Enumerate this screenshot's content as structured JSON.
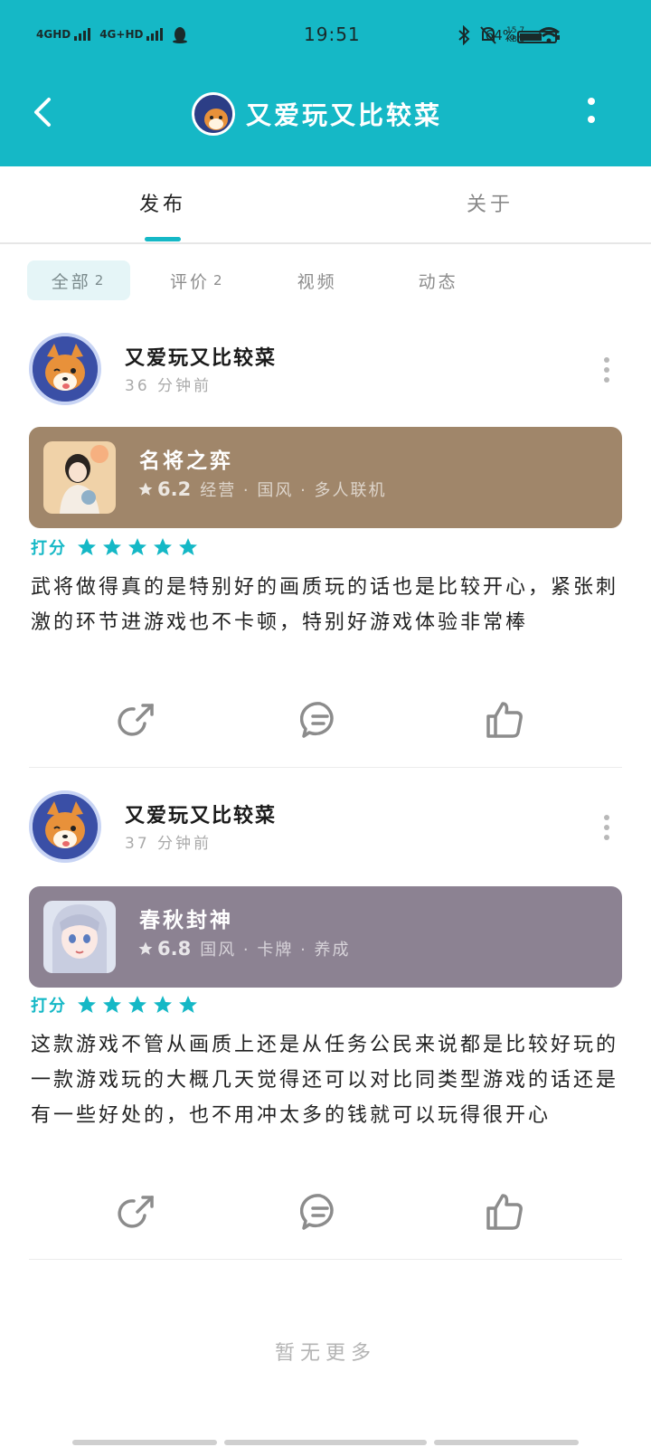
{
  "status_bar": {
    "net1": "4GHD",
    "net2": "4G+HD",
    "time": "19:51",
    "speed": "15.7 KB/s",
    "battery": "64%",
    "battery_level": 0.64
  },
  "header": {
    "title": "又爱玩又比较菜",
    "back_icon": "chevron-left-icon",
    "more_icon": "vertical-dots-icon"
  },
  "tabs": [
    {
      "label": "发布",
      "active": true
    },
    {
      "label": "关于",
      "active": false
    }
  ],
  "filters": [
    {
      "label": "全部",
      "count": "2",
      "active": true
    },
    {
      "label": "评价",
      "count": "2",
      "active": false
    },
    {
      "label": "视频",
      "count": "",
      "active": false
    },
    {
      "label": "动态",
      "count": "",
      "active": false
    }
  ],
  "colors": {
    "accent": "#15b8c6",
    "card1": "#a0866a",
    "card2": "#8c8292"
  },
  "posts": [
    {
      "user": "又爱玩又比较菜",
      "time": "36 分钟前",
      "game": {
        "name": "名将之弈",
        "score": "6.2",
        "tags": "经营 · 国风 · 多人联机"
      },
      "rating_label": "打分",
      "stars": 5,
      "review": "武将做得真的是特别好的画质玩的话也是比较开心，紧张刺激的环节进游戏也不卡顿，特别好游戏体验非常棒"
    },
    {
      "user": "又爱玩又比较菜",
      "time": "37 分钟前",
      "game": {
        "name": "春秋封神",
        "score": "6.8",
        "tags": "国风 · 卡牌 · 养成"
      },
      "rating_label": "打分",
      "stars": 5,
      "review": "这款游戏不管从画质上还是从任务公民来说都是比较好玩的一款游戏玩的大概几天觉得还可以对比同类型游戏的话还是有一些好处的，也不用冲太多的钱就可以玩得很开心"
    }
  ],
  "footer": {
    "no_more": "暂无更多"
  }
}
